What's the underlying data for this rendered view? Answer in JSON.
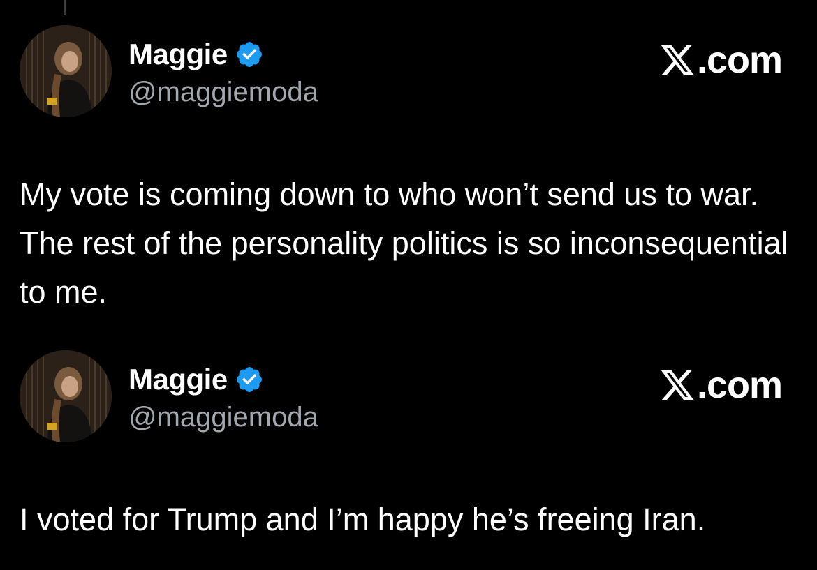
{
  "tweets": [
    {
      "author": {
        "display_name": "Maggie",
        "handle": "@maggiemoda",
        "verified": true,
        "avatar_icon": "profile-photo"
      },
      "brand": {
        "suffix": ".com",
        "logo_icon": "x-logo-icon"
      },
      "text": "My vote is coming down to who won’t send us to war. The rest of the personality politics is so inconsequential to me."
    },
    {
      "author": {
        "display_name": "Maggie",
        "handle": "@maggiemoda",
        "verified": true,
        "avatar_icon": "profile-photo"
      },
      "brand": {
        "suffix": ".com",
        "logo_icon": "x-logo-icon"
      },
      "text": "I voted for Trump and I’m happy he’s freeing Iran."
    }
  ],
  "colors": {
    "background": "#000000",
    "text_primary": "#ffffff",
    "text_secondary": "#a2a8ae",
    "verified_badge": "#1d9bf0"
  }
}
